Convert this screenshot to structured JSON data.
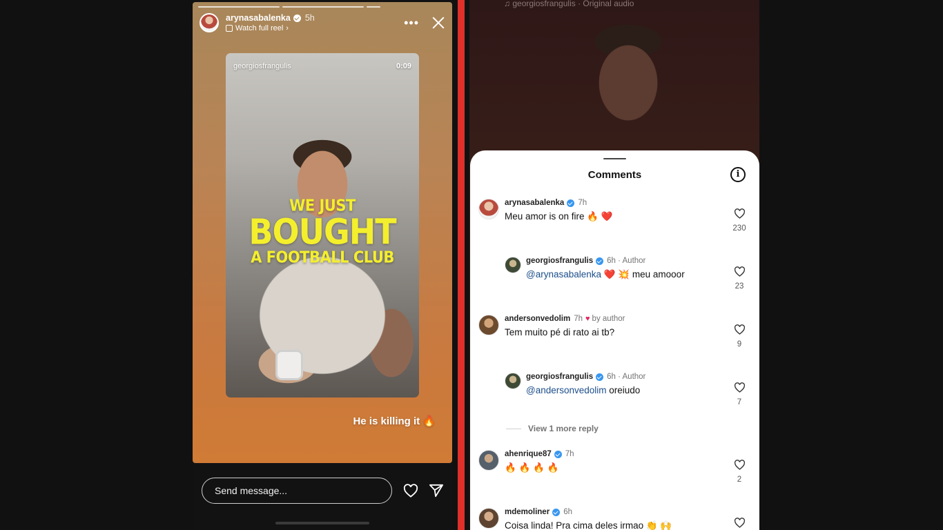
{
  "story": {
    "username": "arynasabalenka",
    "time": "5h",
    "watch_label": "Watch full reel",
    "more_icon": "more-horizontal-icon",
    "close_icon": "close-icon",
    "reel": {
      "username": "georgiosfrangulis",
      "duration": "0:09",
      "caption_line1": "WE JUST",
      "caption_line2": "BOUGHT",
      "caption_line3": "A FOOTBALL CLUB"
    },
    "text_overlay": "He is killing it 🔥",
    "message_placeholder": "Send message...",
    "heart_icon": "heart-icon",
    "send_icon": "send-icon"
  },
  "right": {
    "audio": "georgiosfrangulis · Original audio",
    "sheet_title": "Comments",
    "info_icon": "info-icon",
    "comments": [
      {
        "user": "arynasabalenka",
        "meta": "7h",
        "text": "Meu amor is on fire 🔥 ❤️",
        "likes": "230"
      },
      {
        "user": "georgiosfrangulis",
        "meta": "6h · Author",
        "mention": "@arynasabalenka",
        "text": " ❤️ 💥 meu amooor",
        "likes": "23"
      },
      {
        "user": "andersonvedolim",
        "meta": "7h",
        "by": "by author",
        "text": "Tem muito pé di rato ai tb?",
        "likes": "9"
      },
      {
        "user": "georgiosfrangulis",
        "meta": "6h · Author",
        "mention": "@andersonvedolim",
        "text": " oreiudo",
        "likes": "7"
      },
      {
        "user": "ahenrique87",
        "meta": "7h",
        "text": "🔥 🔥 🔥 🔥",
        "likes": "2"
      },
      {
        "user": "mdemoliner",
        "meta": "6h",
        "text": "Coisa linda! Pra cima deles irmao 👏 🙌",
        "likes": ""
      }
    ],
    "view_more": "View 1 more reply"
  },
  "colors": {
    "divider": "#e0302a",
    "verified": "#3897f0",
    "mention": "#1c4e8a",
    "caption": "#f4ef2c"
  }
}
